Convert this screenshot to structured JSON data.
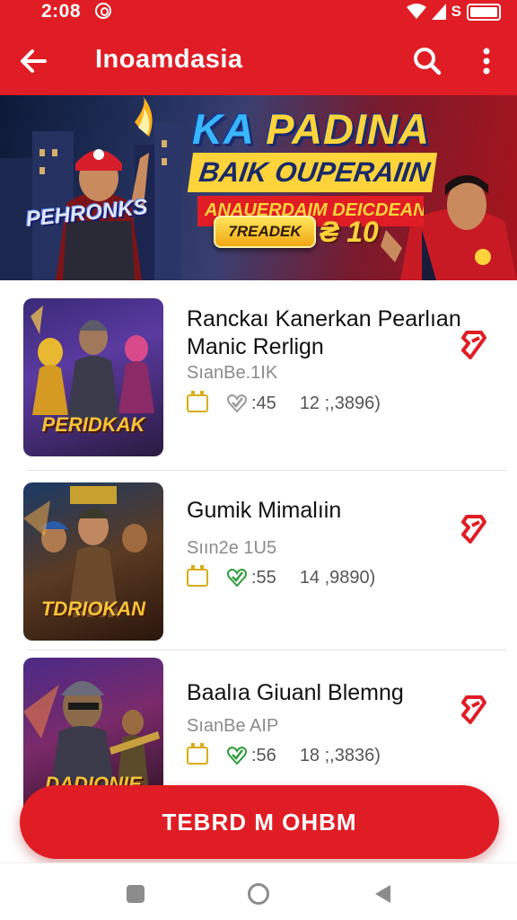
{
  "status_bar": {
    "time": "2:08",
    "carrier_glyph": "S"
  },
  "app_bar": {
    "title": "Inoamdasia"
  },
  "banner": {
    "title_part1": "KA ",
    "title_part2": "PADINA",
    "subtitle": "BAIK OUPERAIIN",
    "tagline": "ANAUERDAIM DEICDEANI",
    "cta_label": "7READEK",
    "price": "₴ 10",
    "logo_text": "PEHRONKS"
  },
  "games": [
    {
      "title": "Ranckaı Kanerkan Pearlıan Manic Rerlign",
      "subtitle": "SıanBe.1IK",
      "rating": ":45",
      "count": "12 ;,3896)",
      "thumb_caption": "PERIDKAK",
      "check_color": "#9a9a9a"
    },
    {
      "title": "Gumik Mimalıin",
      "subtitle": "Sıın2e 1U5",
      "rating": ":55",
      "count": "14 ,9890)",
      "thumb_caption": "TDRIOKAN",
      "check_color": "#2e9c3a"
    },
    {
      "title": "Baalıa Giuanl Blemng",
      "subtitle": "SıanBe AIP",
      "rating": ":56",
      "count": "18 ;,3836)",
      "thumb_caption": "DADIONIE",
      "check_color": "#2e9c3a"
    }
  ],
  "trend_button": {
    "label": "TEBRD M OHBM"
  },
  "colors": {
    "primary": "#e01d24",
    "accent": "#ffd43a",
    "bookmark": "#e01d24"
  },
  "icons": [
    "back-arrow-icon",
    "search-icon",
    "more-vert-icon",
    "bookmark-icon",
    "calendar-icon",
    "check-heart-icon"
  ]
}
